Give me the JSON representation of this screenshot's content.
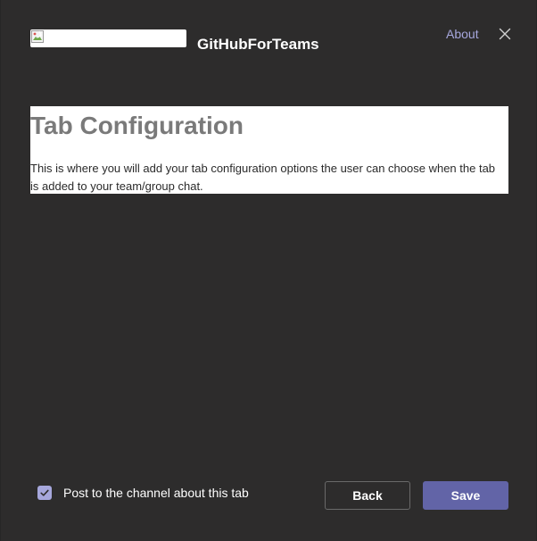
{
  "header": {
    "app_name": "GitHubForTeams",
    "about_label": "About",
    "logo_icon": "broken-image-icon",
    "close_icon": "close-icon"
  },
  "config": {
    "title": "Tab Configuration",
    "description": "This is where you will add your tab configuration options the user can choose when the tab is added to your team/group chat."
  },
  "footer": {
    "post_checkbox": {
      "label": "Post to the channel about this tab",
      "checked": true
    },
    "back_label": "Back",
    "save_label": "Save"
  },
  "colors": {
    "dialog_background": "#2d2c2c",
    "accent": "#6264a7",
    "link": "#a6a7dc",
    "panel_background": "#ffffff"
  }
}
